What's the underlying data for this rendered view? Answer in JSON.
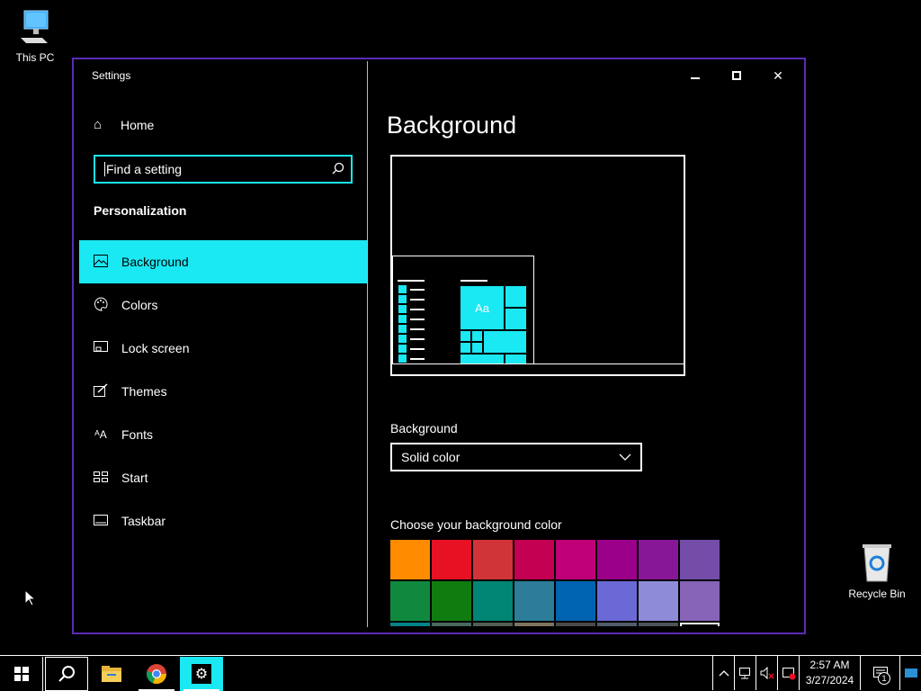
{
  "desktop": {
    "this_pc_label": "This PC",
    "recycle_bin_label": "Recycle Bin"
  },
  "window": {
    "title": "Settings",
    "minimize_icon": "minimize-icon",
    "maximize_icon": "maximize-icon",
    "close_icon": "close-icon"
  },
  "sidebar": {
    "home_label": "Home",
    "search_placeholder": "Find a setting",
    "section_title": "Personalization",
    "items": [
      {
        "label": "Background",
        "icon": "picture-icon",
        "active": true
      },
      {
        "label": "Colors",
        "icon": "palette-icon",
        "active": false
      },
      {
        "label": "Lock screen",
        "icon": "lock-screen-icon",
        "active": false
      },
      {
        "label": "Themes",
        "icon": "brush-icon",
        "active": false
      },
      {
        "label": "Fonts",
        "icon": "fonts-icon",
        "active": false
      },
      {
        "label": "Start",
        "icon": "start-icon",
        "active": false
      },
      {
        "label": "Taskbar",
        "icon": "taskbar-icon",
        "active": false
      }
    ]
  },
  "main": {
    "title": "Background",
    "preview_tile_text": "Aa",
    "background_label": "Background",
    "background_value": "Solid color",
    "color_section_label": "Choose your background color",
    "swatches": [
      "#ff8c00",
      "#e81123",
      "#d13438",
      "#c30052",
      "#bf0077",
      "#9a0089",
      "#881798",
      "#744da9",
      "#10893e",
      "#107c10",
      "#018574",
      "#2d7d9a",
      "#0063b1",
      "#6b69d6",
      "#8e8cd8",
      "#8764b8",
      "#038387",
      "#486860",
      "#525e54",
      "#7e735f",
      "#4c4a48",
      "#515c6b",
      "#4a5459",
      "#000000"
    ]
  },
  "taskbar": {
    "time": "2:57 AM",
    "date": "3/27/2024",
    "notification_count": "1"
  },
  "colors": {
    "accent": "#1ae8f3",
    "window_border": "#5b2bb5"
  }
}
